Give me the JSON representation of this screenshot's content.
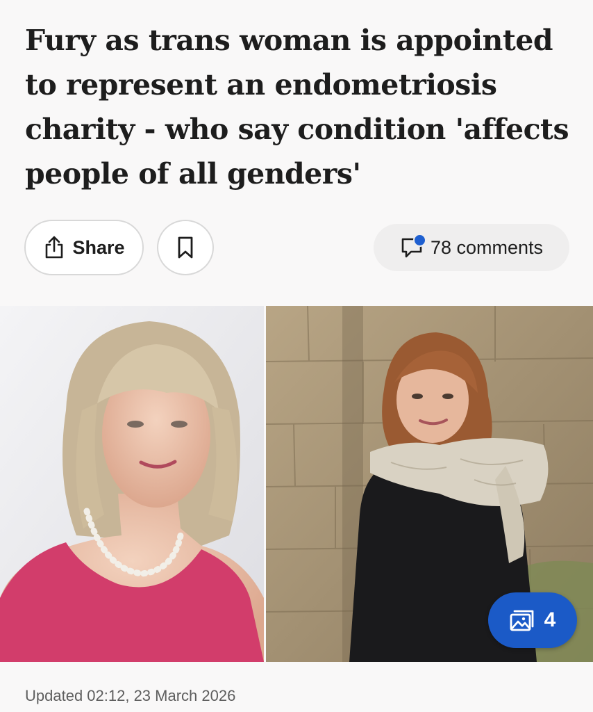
{
  "article": {
    "headline": "Fury as trans woman is appointed to represent an endometriosis charity - who say condition 'affects people of all genders'",
    "updated": "Updated 02:12, 23 March 2026"
  },
  "actions": {
    "share_label": "Share",
    "share_icon": "share-icon",
    "bookmark_icon": "bookmark-icon",
    "comments_label": "78 comments",
    "comments_icon": "comment-bubble-icon",
    "notification_dot_color": "#1e5fd0"
  },
  "gallery": {
    "count": "4",
    "icon": "gallery-icon",
    "badge_color": "#1b5ac7"
  }
}
